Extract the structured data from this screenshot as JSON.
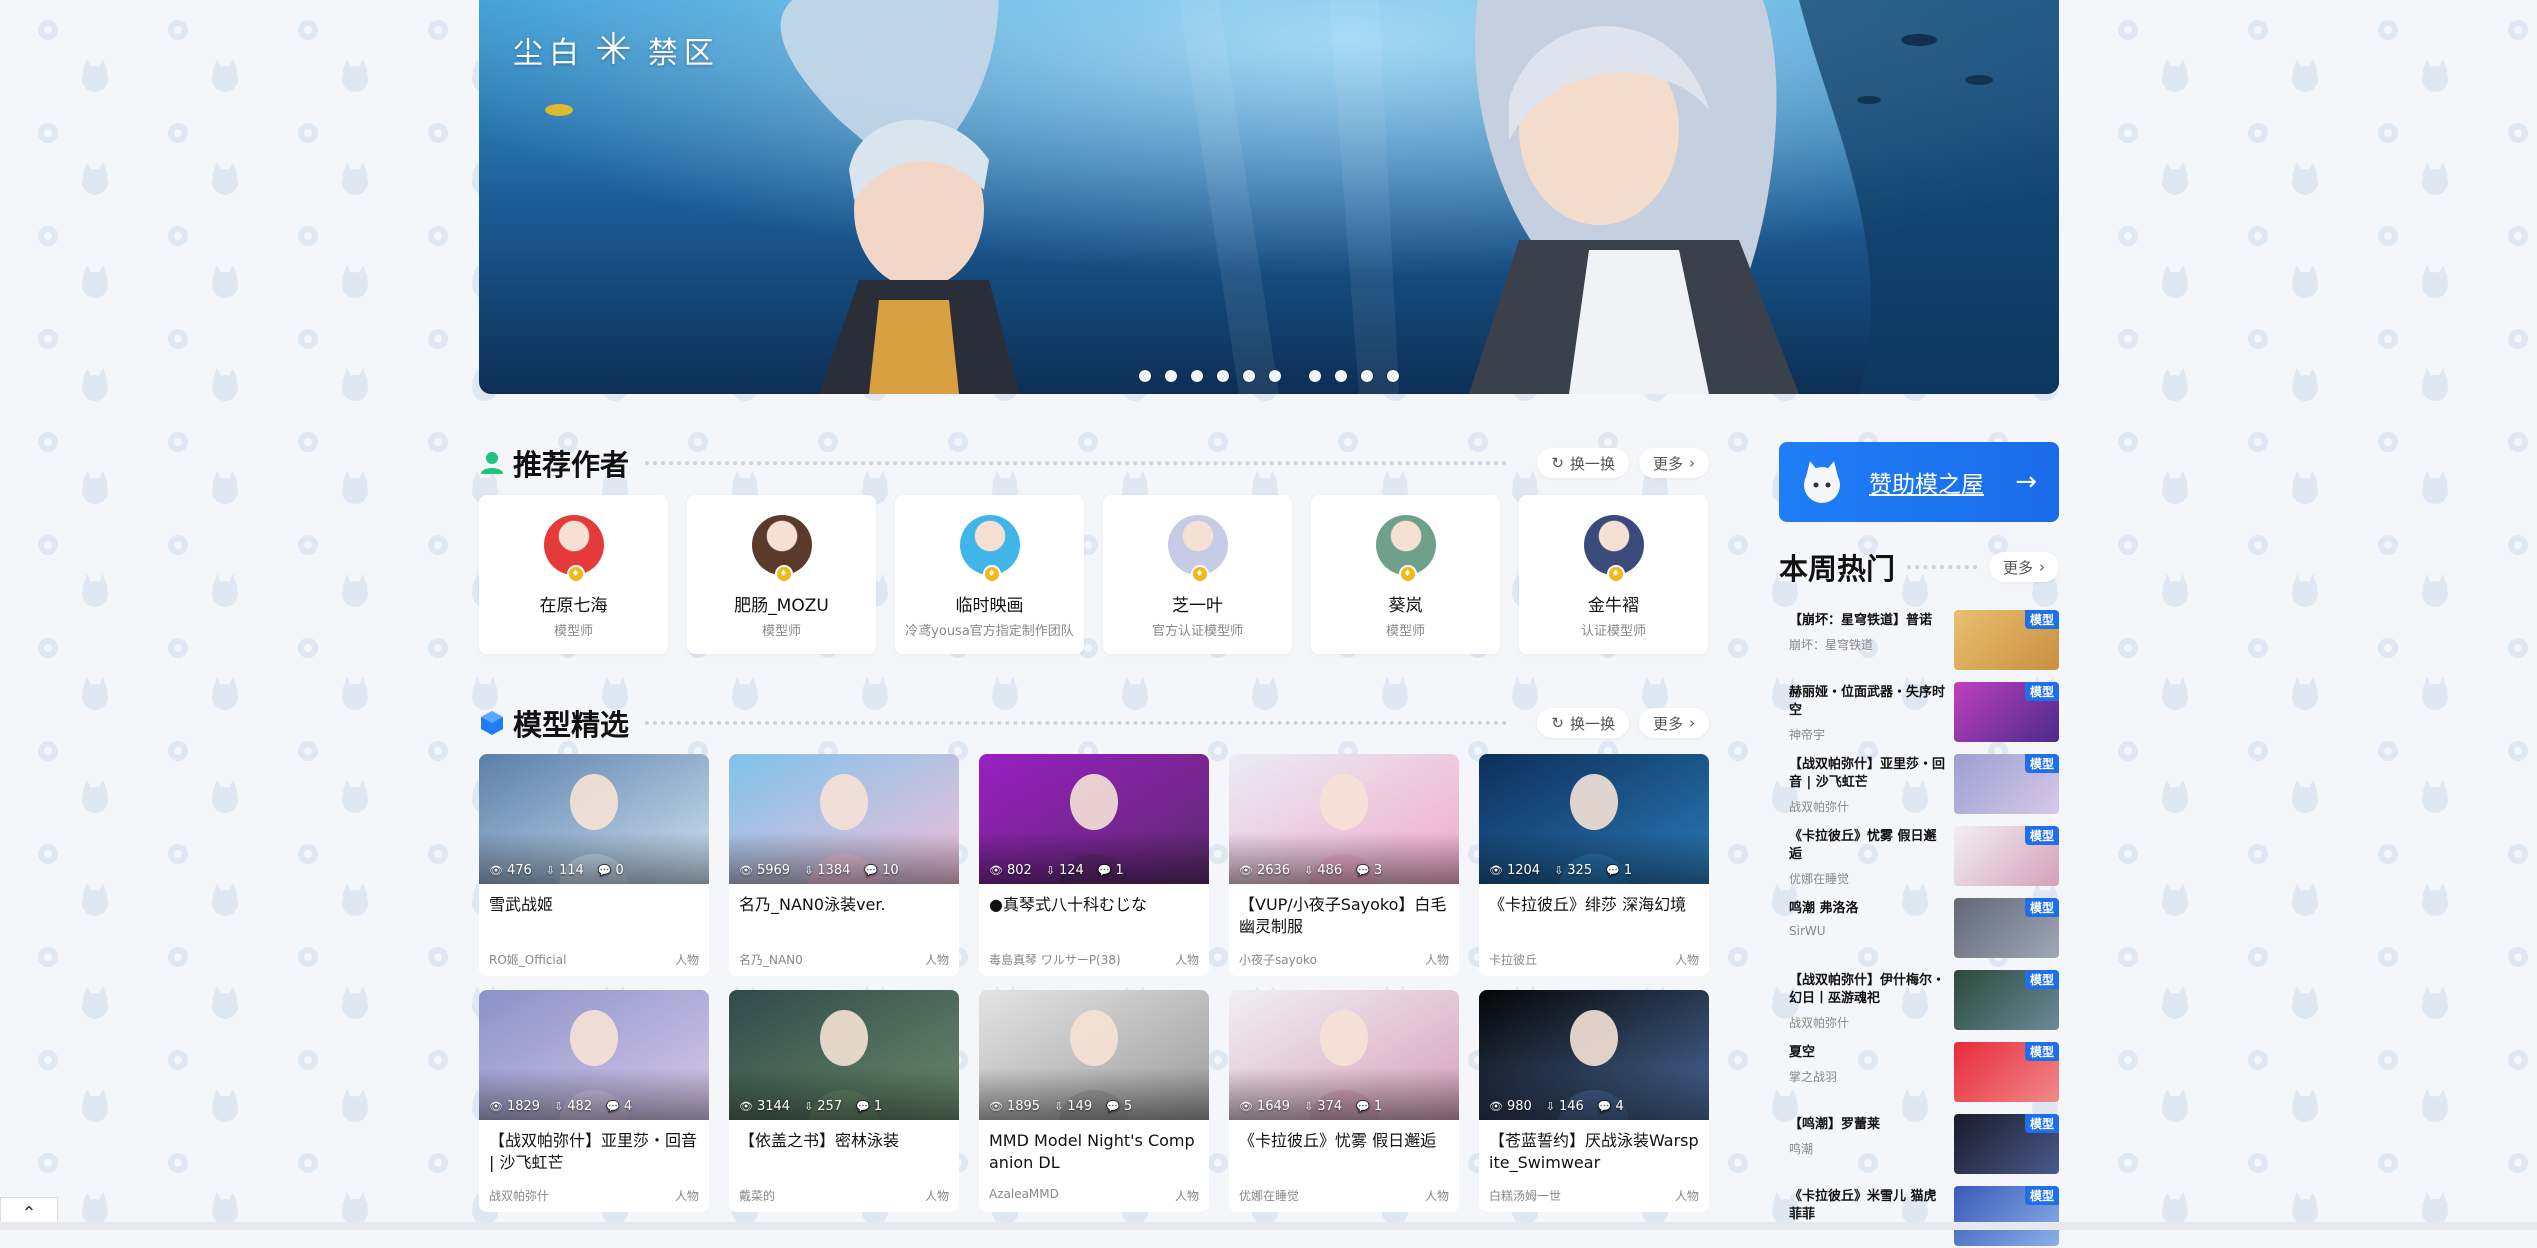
{
  "banner": {
    "logo_left": "尘白",
    "logo_right": "禁区",
    "logo_mark": "✳",
    "dot_count": 10
  },
  "authors_section": {
    "title": "推荐作者",
    "refresh_label": "换一换",
    "more_label": "更多",
    "items": [
      {
        "name": "在原七海",
        "role": "模型师",
        "color": "#e43a3a"
      },
      {
        "name": "肥肠_MOZU",
        "role": "模型师",
        "color": "#5a3a2a"
      },
      {
        "name": "临时映画",
        "role": "冷鸢yousa官方指定制作团队",
        "color": "#3fb5e8"
      },
      {
        "name": "芝一叶",
        "role": "官方认证模型师",
        "color": "#c6cbe6"
      },
      {
        "name": "葵岚",
        "role": "模型师",
        "color": "#6fa089"
      },
      {
        "name": "金牛褶",
        "role": "认证模型师",
        "color": "#3a4a7a"
      }
    ]
  },
  "models_section": {
    "title": "模型精选",
    "refresh_label": "换一换",
    "more_label": "更多",
    "items": [
      {
        "title": "雪武战姬",
        "author": "RO姬_Official",
        "category": "人物",
        "views": "476",
        "downloads": "114",
        "comments": "0",
        "c1": "#5b7fa8",
        "c2": "#cfe3f4"
      },
      {
        "title": "名乃_NAN0泳装ver.",
        "author": "名乃_NAN0",
        "category": "人物",
        "views": "5969",
        "downloads": "1384",
        "comments": "10",
        "c1": "#7fc2ea",
        "c2": "#f2c0d8"
      },
      {
        "title": "●真琴式八十科むじな",
        "author": "毒島真琴 ワルサーP(38)",
        "category": "人物",
        "views": "802",
        "downloads": "124",
        "comments": "1",
        "c1": "#9a1fc4",
        "c2": "#5a2a6a"
      },
      {
        "title": "【VUP/小夜子Sayoko】白毛幽灵制服",
        "author": "小夜子sayoko",
        "category": "人物",
        "views": "2636",
        "downloads": "486",
        "comments": "3",
        "c1": "#e9edf5",
        "c2": "#f1a9c8"
      },
      {
        "title": "《卡拉彼丘》绯莎 深海幻境",
        "author": "卡拉彼丘",
        "category": "人物",
        "views": "1204",
        "downloads": "325",
        "comments": "1",
        "c1": "#0d2f5a",
        "c2": "#2a7ab8"
      },
      {
        "title": "【战双帕弥什】亚里莎・回音 | 沙飞虹芒",
        "author": "战双帕弥什",
        "category": "人物",
        "views": "1829",
        "downloads": "482",
        "comments": "4",
        "c1": "#8a92c8",
        "c2": "#d8c8ea"
      },
      {
        "title": "【依盖之书】密林泳装",
        "author": "戴菜的",
        "category": "人物",
        "views": "3144",
        "downloads": "257",
        "comments": "1",
        "c1": "#2f4a4a",
        "c2": "#6a8a6a"
      },
      {
        "title": "MMD Model Night's Companion DL",
        "author": "AzaleaMMD",
        "category": "人物",
        "views": "1895",
        "downloads": "149",
        "comments": "5",
        "c1": "#e4e4e4",
        "c2": "#9a9a9a"
      },
      {
        "title": "《卡拉彼丘》忧雾 假日邂逅",
        "author": "优娜在睡觉",
        "category": "人物",
        "views": "1649",
        "downloads": "374",
        "comments": "1",
        "c1": "#f0f0f4",
        "c2": "#d6a0b8"
      },
      {
        "title": "【苍蓝誓约】厌战泳装Warspite_Swimwear",
        "author": "白糕汤姆一世",
        "category": "人物",
        "views": "980",
        "downloads": "146",
        "comments": "4",
        "c1": "#050505",
        "c2": "#4a6a9a"
      }
    ]
  },
  "sponsor": {
    "label": "赞助模之屋",
    "arrow": "→"
  },
  "hot_section": {
    "title": "本周热门",
    "more_label": "更多",
    "tag_label": "模型",
    "items": [
      {
        "title": "【崩坏：星穹铁道】普诺",
        "author": "崩坏：星穹铁道",
        "c1": "#e8c070",
        "c2": "#c89040"
      },
      {
        "title": "赫丽娅・位面武器・失序时空",
        "author": "神帝宇",
        "c1": "#c040c0",
        "c2": "#4a2a8a"
      },
      {
        "title": "【战双帕弥什】亚里莎・回音 | 沙飞虹芒",
        "author": "战双帕弥什",
        "c1": "#9aa0d0",
        "c2": "#d8c8e8"
      },
      {
        "title": "《卡拉彼丘》忧雾 假日邂逅",
        "author": "优娜在睡觉",
        "c1": "#f0f0f4",
        "c2": "#d6a0b8"
      },
      {
        "title": "鸣潮 弗洛洛",
        "author": "SirWU",
        "c1": "#606878",
        "c2": "#a0a8b8"
      },
      {
        "title": "【战双帕弥什】伊什梅尔・幻日丨巫游魂祀",
        "author": "战双帕弥什",
        "c1": "#2a4a3a",
        "c2": "#6a8a9a"
      },
      {
        "title": "夏空",
        "author": "掌之战羽",
        "c1": "#e82a3a",
        "c2": "#f08a8a"
      },
      {
        "title": "【鸣潮】罗蕾莱",
        "author": "鸣潮",
        "c1": "#1a1a2a",
        "c2": "#4a5a8a"
      },
      {
        "title": "《卡拉彼丘》米雪儿 猫虎菲菲",
        "author": "",
        "c1": "#3a5ab8",
        "c2": "#8ab0e8"
      }
    ]
  },
  "back_to_top": "⌃"
}
